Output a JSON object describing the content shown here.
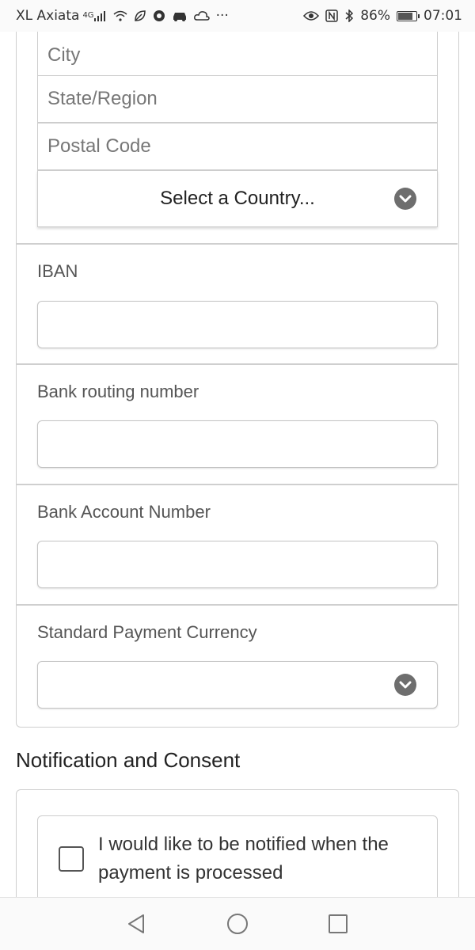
{
  "status_bar": {
    "carrier": "XL Axiata",
    "network": "4G",
    "battery_percent": "86%",
    "battery_level": 0.86,
    "time": "07:01",
    "more": "···"
  },
  "address": {
    "city_placeholder": "City",
    "state_placeholder": "State/Region",
    "postal_placeholder": "Postal Code",
    "country_select": "Select a Country..."
  },
  "bank": {
    "iban_label": "IBAN",
    "routing_label": "Bank routing number",
    "account_label": "Bank Account Number",
    "currency_label": "Standard Payment Currency",
    "currency_value": ""
  },
  "notification": {
    "title": "Notification and Consent",
    "consent_text": "I would like to be notified when the payment is processed"
  },
  "colors": {
    "border": "#cfcfcf",
    "chevron_bg": "#6e6e6e",
    "text": "#333333"
  }
}
